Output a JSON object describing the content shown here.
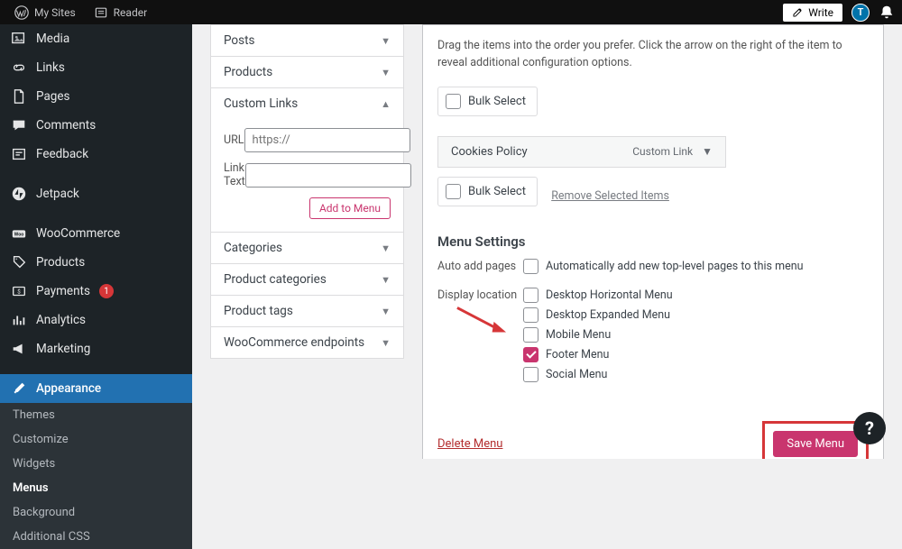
{
  "topbar": {
    "my_sites": "My Sites",
    "reader": "Reader",
    "write": "Write",
    "user_initial": "T"
  },
  "sidebar": {
    "media": "Media",
    "links": "Links",
    "pages": "Pages",
    "comments": "Comments",
    "feedback": "Feedback",
    "jetpack": "Jetpack",
    "woocommerce": "WooCommerce",
    "products": "Products",
    "payments": "Payments",
    "payments_badge": "1",
    "analytics": "Analytics",
    "marketing": "Marketing",
    "appearance": "Appearance",
    "sub": {
      "themes": "Themes",
      "customize": "Customize",
      "widgets": "Widgets",
      "menus": "Menus",
      "background": "Background",
      "additional_css": "Additional CSS"
    }
  },
  "metaboxes": {
    "posts": "Posts",
    "products": "Products",
    "custom_links": "Custom Links",
    "url_label": "URL",
    "url_placeholder": "https://",
    "link_text_label": "Link Text",
    "add_to_menu": "Add to Menu",
    "categories": "Categories",
    "product_categories": "Product categories",
    "product_tags": "Product tags",
    "woo_endpoints": "WooCommerce endpoints"
  },
  "panel": {
    "instructions": "Drag the items into the order you prefer. Click the arrow on the right of the item to reveal additional configuration options.",
    "bulk_select": "Bulk Select",
    "item_title": "Cookies Policy",
    "item_type": "Custom Link",
    "remove_selected": "Remove Selected Items",
    "settings_heading": "Menu Settings",
    "auto_add_label": "Auto add pages",
    "auto_add_opt": "Automatically add new top-level pages to this menu",
    "display_loc_label": "Display location",
    "loc1": "Desktop Horizontal Menu",
    "loc2": "Desktop Expanded Menu",
    "loc3": "Mobile Menu",
    "loc4": "Footer Menu",
    "loc5": "Social Menu",
    "delete_menu": "Delete Menu",
    "save_menu": "Save Menu"
  }
}
